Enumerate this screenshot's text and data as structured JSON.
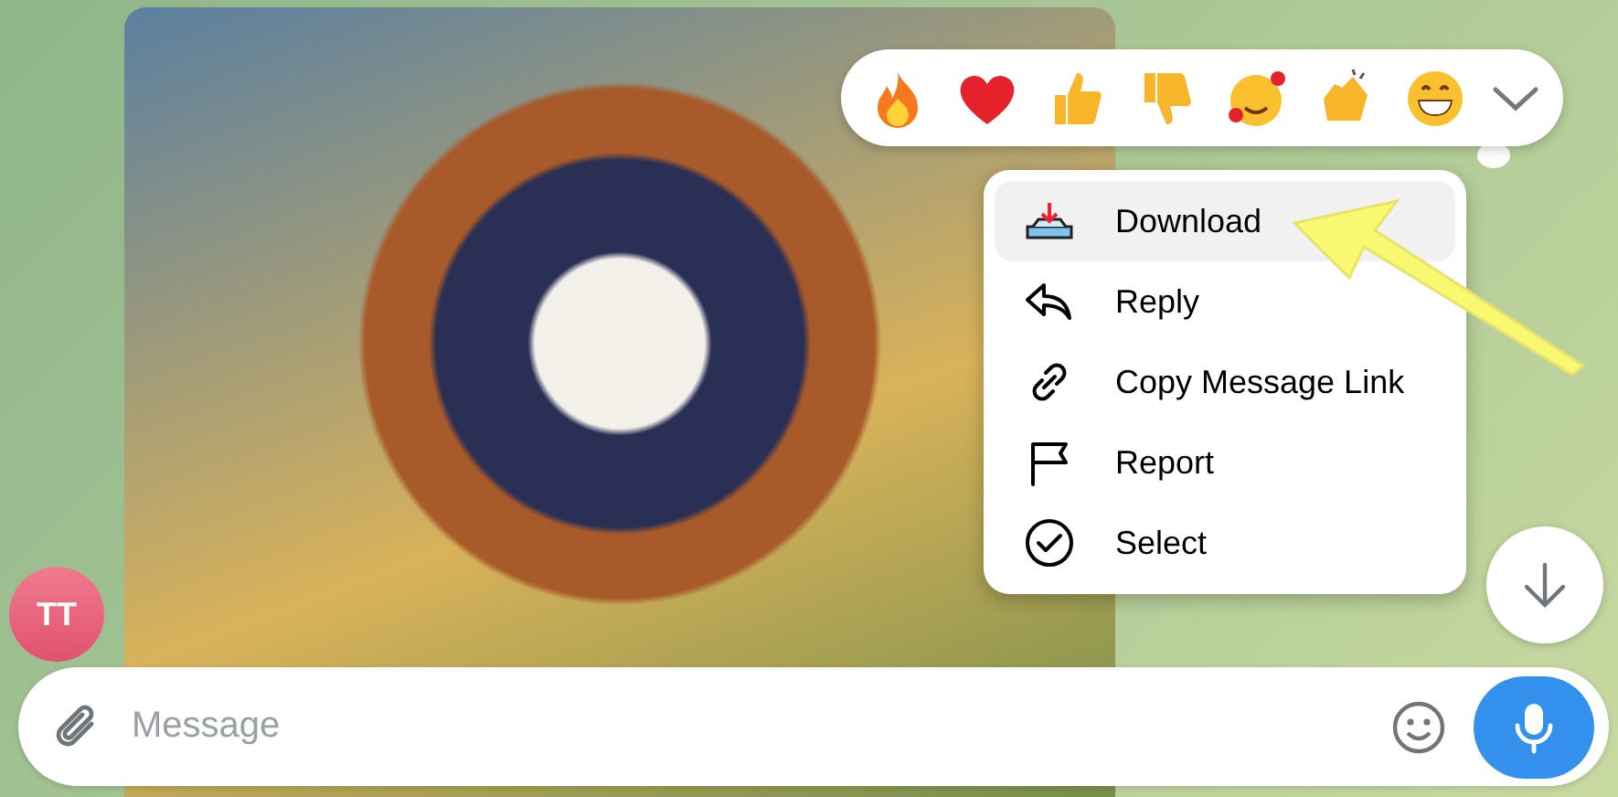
{
  "avatar": {
    "initials": "TT"
  },
  "context_menu": {
    "items": [
      {
        "label": "Download",
        "kind": "download",
        "selected": true
      },
      {
        "label": "Reply",
        "kind": "reply",
        "selected": false
      },
      {
        "label": "Copy Message Link",
        "kind": "link",
        "selected": false
      },
      {
        "label": "Report",
        "kind": "report",
        "selected": false
      },
      {
        "label": "Select",
        "kind": "select",
        "selected": false
      }
    ]
  },
  "composer": {
    "placeholder": "Message"
  }
}
